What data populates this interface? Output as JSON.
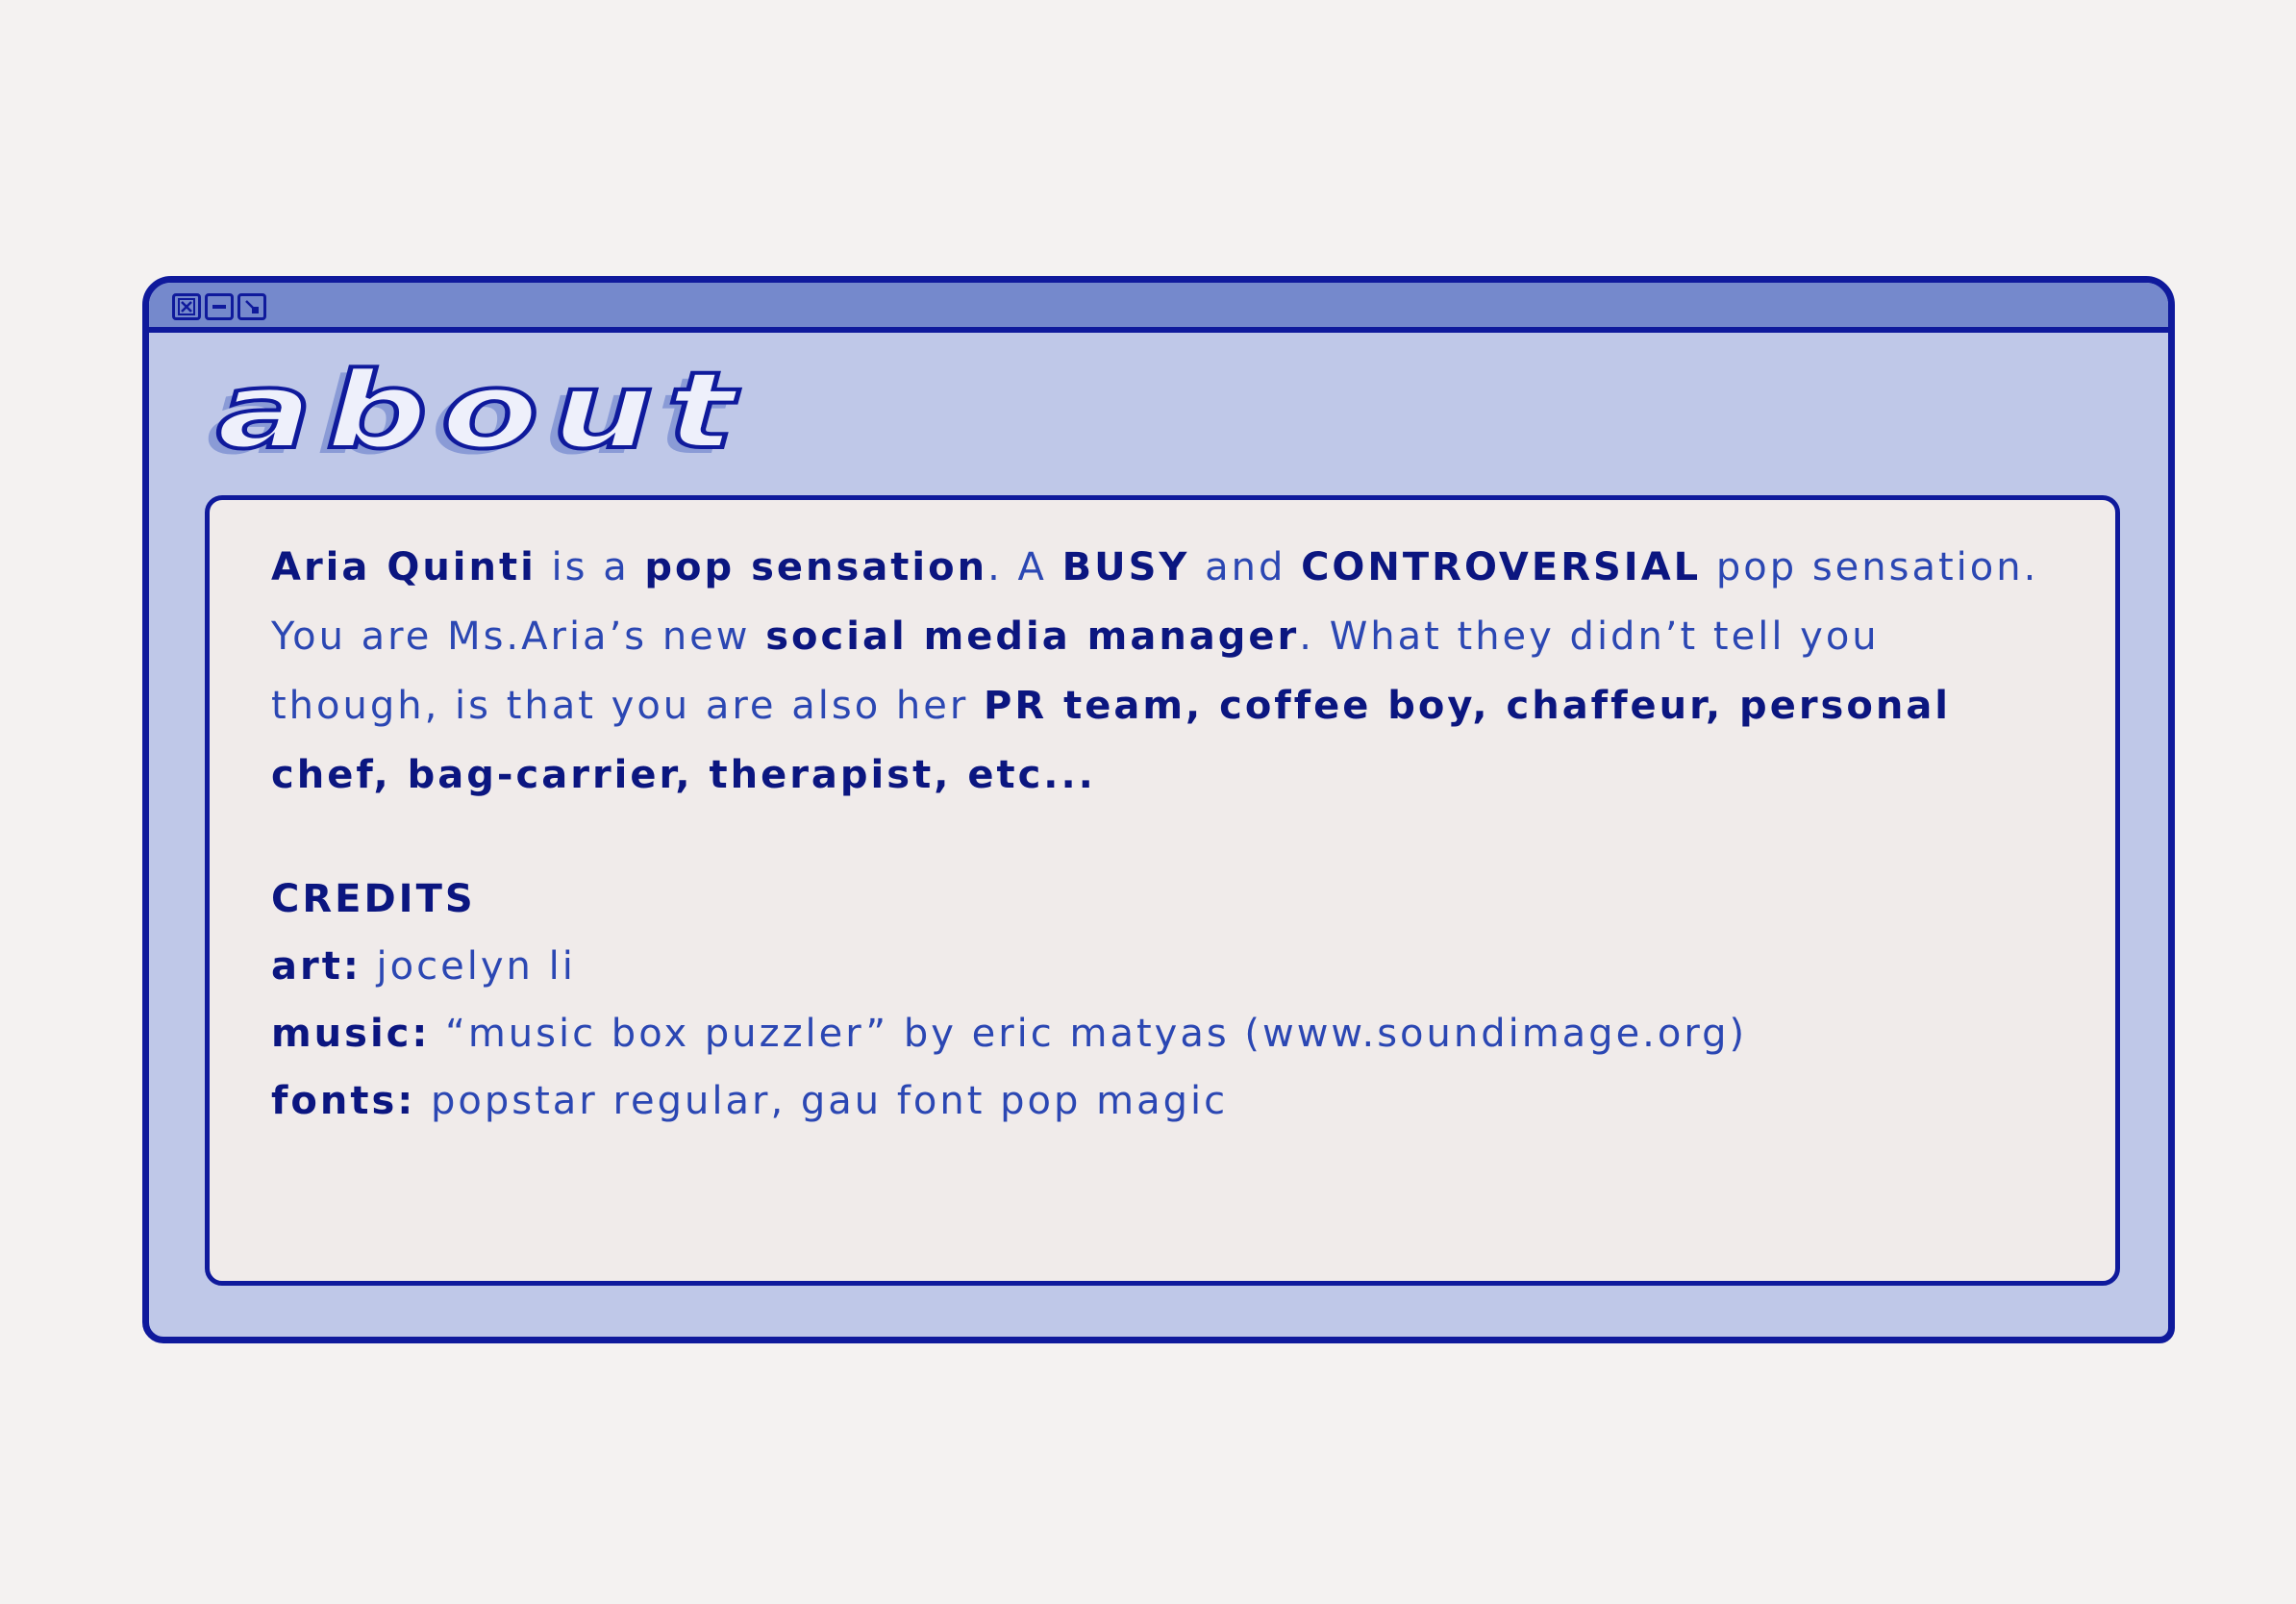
{
  "window": {
    "controls": [
      "close-icon",
      "minimize-icon",
      "resize-icon"
    ],
    "title": "about"
  },
  "about": {
    "p1": "Aria Quinti",
    "p2": " is a ",
    "p3": "pop sensation",
    "p4": ". A ",
    "p5": "BUSY",
    "p6": " and ",
    "p7": "CONTROVERSIAL",
    "p8": " pop sensation. You are Ms.Aria’s new ",
    "p9": "social media manager",
    "p10": ". What they didn’t tell you though, is that you are also her ",
    "p11": "PR team, coffee boy, chaffeur, personal chef, bag-carrier, therapist, etc...",
    "colors": {
      "dark": "#0b1680",
      "light": "#2b47b3"
    }
  },
  "credits": {
    "title": "CREDITS",
    "art_label": "art:",
    "art_value": " jocelyn li",
    "music_label": "music:",
    "music_value": " “music box puzzler” by eric matyas (www.soundimage.org)",
    "fonts_label": "fonts:",
    "fonts_value": " popstar regular, gau font pop magic"
  }
}
